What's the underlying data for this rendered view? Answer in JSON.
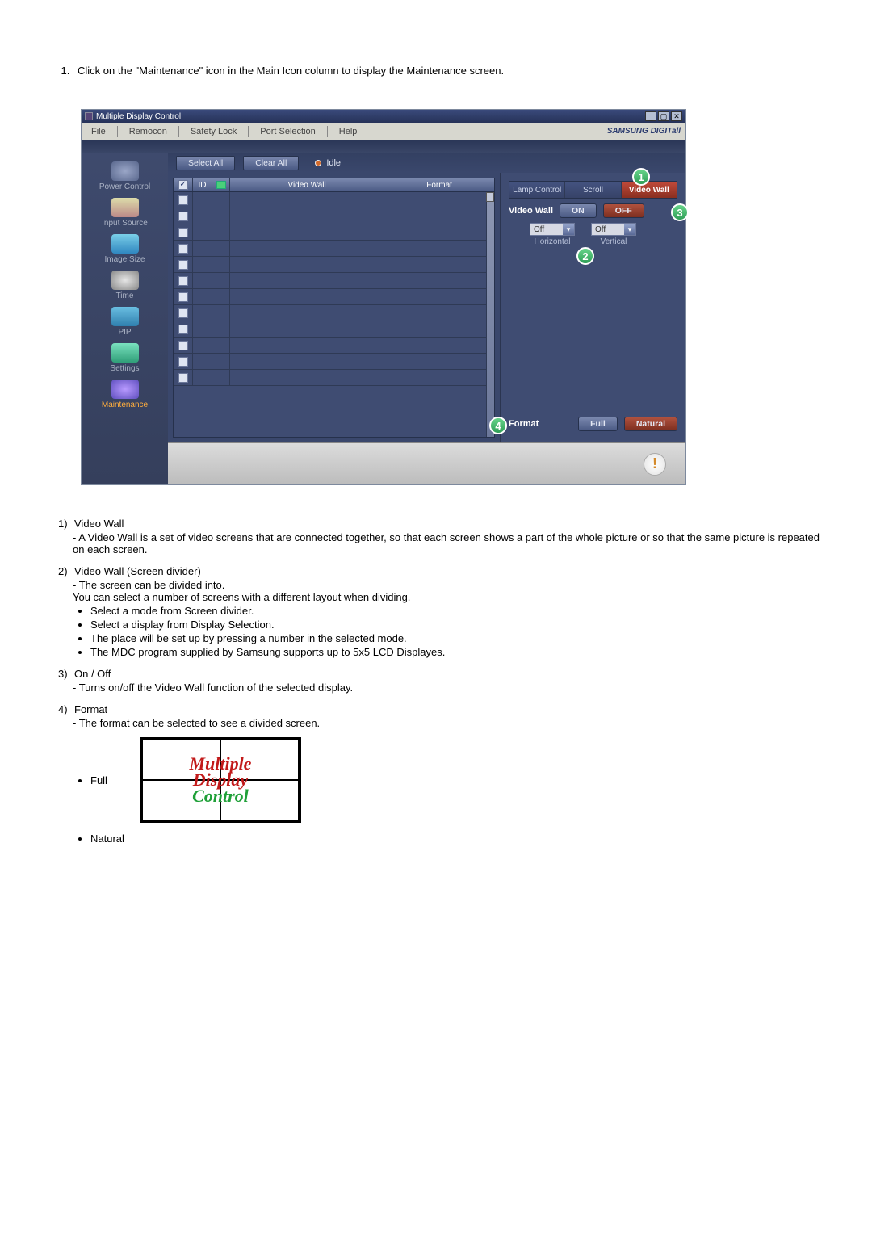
{
  "intro_item": "Click on the \"Maintenance\" icon in the Main Icon column to display the Maintenance screen.",
  "app": {
    "title": "Multiple Display Control",
    "menu": {
      "file": "File",
      "remocon": "Remocon",
      "safety": "Safety Lock",
      "port": "Port Selection",
      "help": "Help"
    },
    "brand": "SAMSUNG DIGITall",
    "toolbar": {
      "select_all": "Select All",
      "clear_all": "Clear All",
      "idle": "Idle"
    },
    "grid_headers": {
      "id": "ID",
      "video_wall": "Video Wall",
      "format": "Format"
    },
    "sidebar": {
      "power": "Power Control",
      "input": "Input Source",
      "image": "Image Size",
      "time": "Time",
      "pip": "PIP",
      "settings": "Settings",
      "maintenance": "Maintenance"
    },
    "tabs": {
      "lamp": "Lamp Control",
      "scroll": "Scroll",
      "videowall": "Video Wall"
    },
    "videowall_label": "Video Wall",
    "on_label": "ON",
    "off_label": "OFF",
    "select_off": "Off",
    "horizontal": "Horizontal",
    "vertical": "Vertical",
    "format_label": "Format",
    "full_btn": "Full",
    "natural_btn": "Natural",
    "callouts": {
      "c1": "1",
      "c2": "2",
      "c3": "3",
      "c4": "4"
    },
    "win": {
      "min": "_",
      "max": "▢",
      "close": "✕"
    }
  },
  "explain": {
    "n1": "1)",
    "t1": "Video Wall",
    "d1": "A Video Wall is a set of video screens that are connected together, so that each screen shows a part of the whole picture or so that the same picture is repeated on each screen.",
    "n2": "2)",
    "t2": "Video Wall (Screen divider)",
    "d2a": "The screen can be divided into.",
    "d2b": "You can select a number of screens with a different layout when dividing.",
    "b2a": "Select a mode from Screen divider.",
    "b2b": "Select a display from Display Selection.",
    "b2c": "The place will be set up by pressing a number in the selected mode.",
    "b2d": "The MDC program supplied by Samsung supports up to 5x5 LCD Displayes.",
    "n3": "3)",
    "t3": "On / Off",
    "d3": "Turns on/off the Video Wall function of the selected display.",
    "n4": "4)",
    "t4": "Format",
    "d4": "The format can be selected to see a divided screen.",
    "full_label": "Full",
    "natural_label": "Natural",
    "overlay_l1": "Multiple",
    "overlay_l2": "Display",
    "overlay_l3": "Control"
  }
}
